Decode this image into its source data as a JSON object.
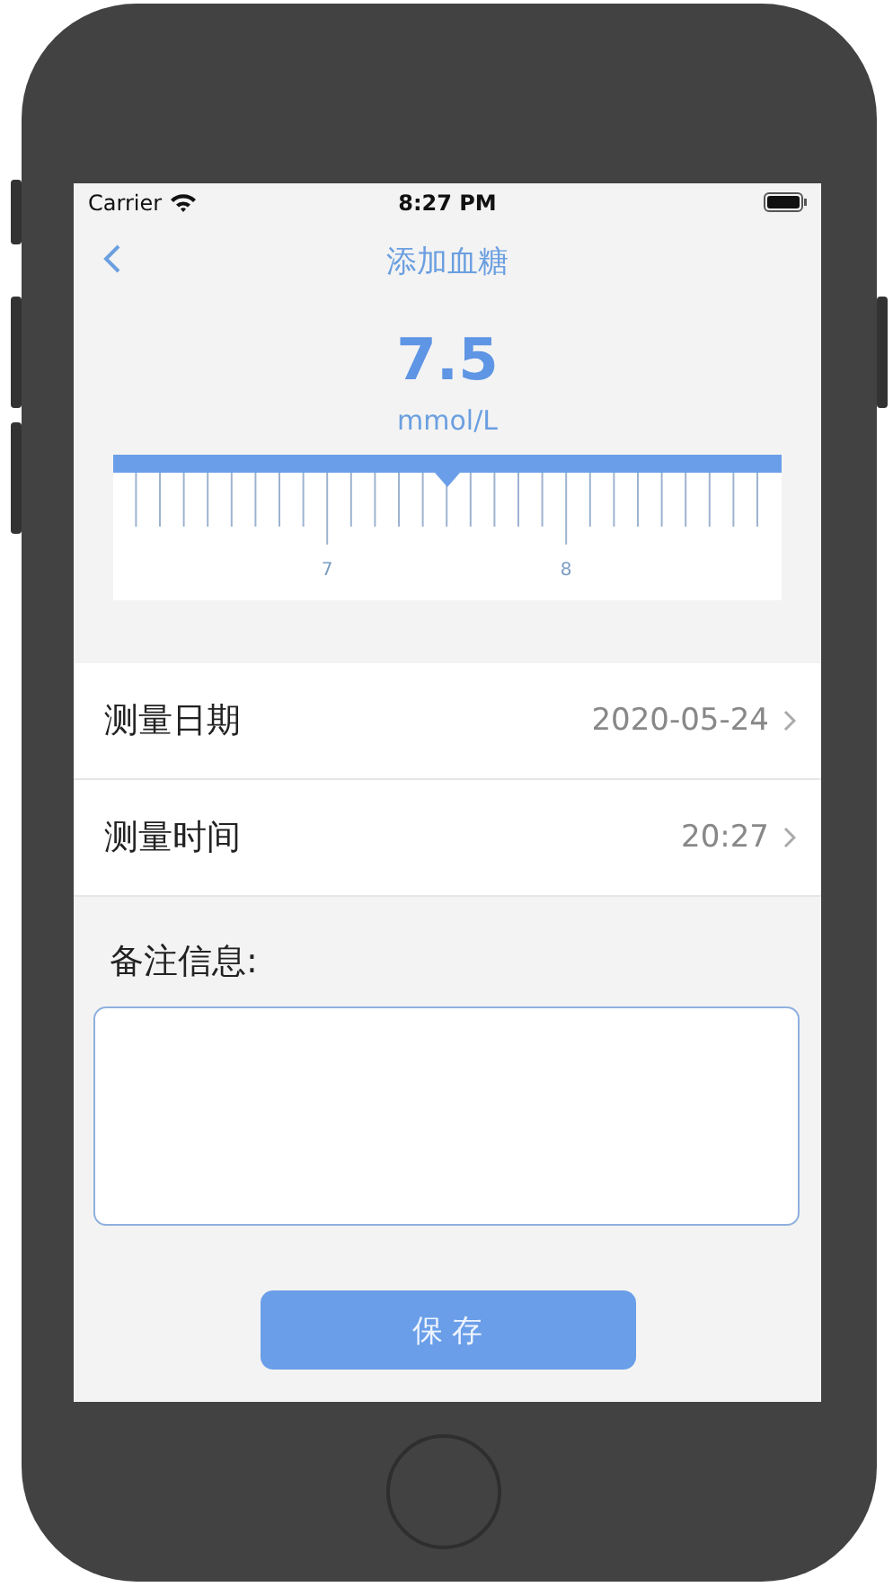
{
  "status_bar": {
    "carrier": "Carrier",
    "time": "8:27 PM"
  },
  "nav": {
    "title": "添加血糖"
  },
  "reading": {
    "value": "7.5",
    "unit": "mmol/L"
  },
  "ruler": {
    "labels": [
      "7",
      "8"
    ]
  },
  "rows": [
    {
      "label": "测量日期",
      "value": "2020-05-24"
    },
    {
      "label": "测量时间",
      "value": "20:27"
    }
  ],
  "note": {
    "label": "备注信息:"
  },
  "save_button": "保 存"
}
